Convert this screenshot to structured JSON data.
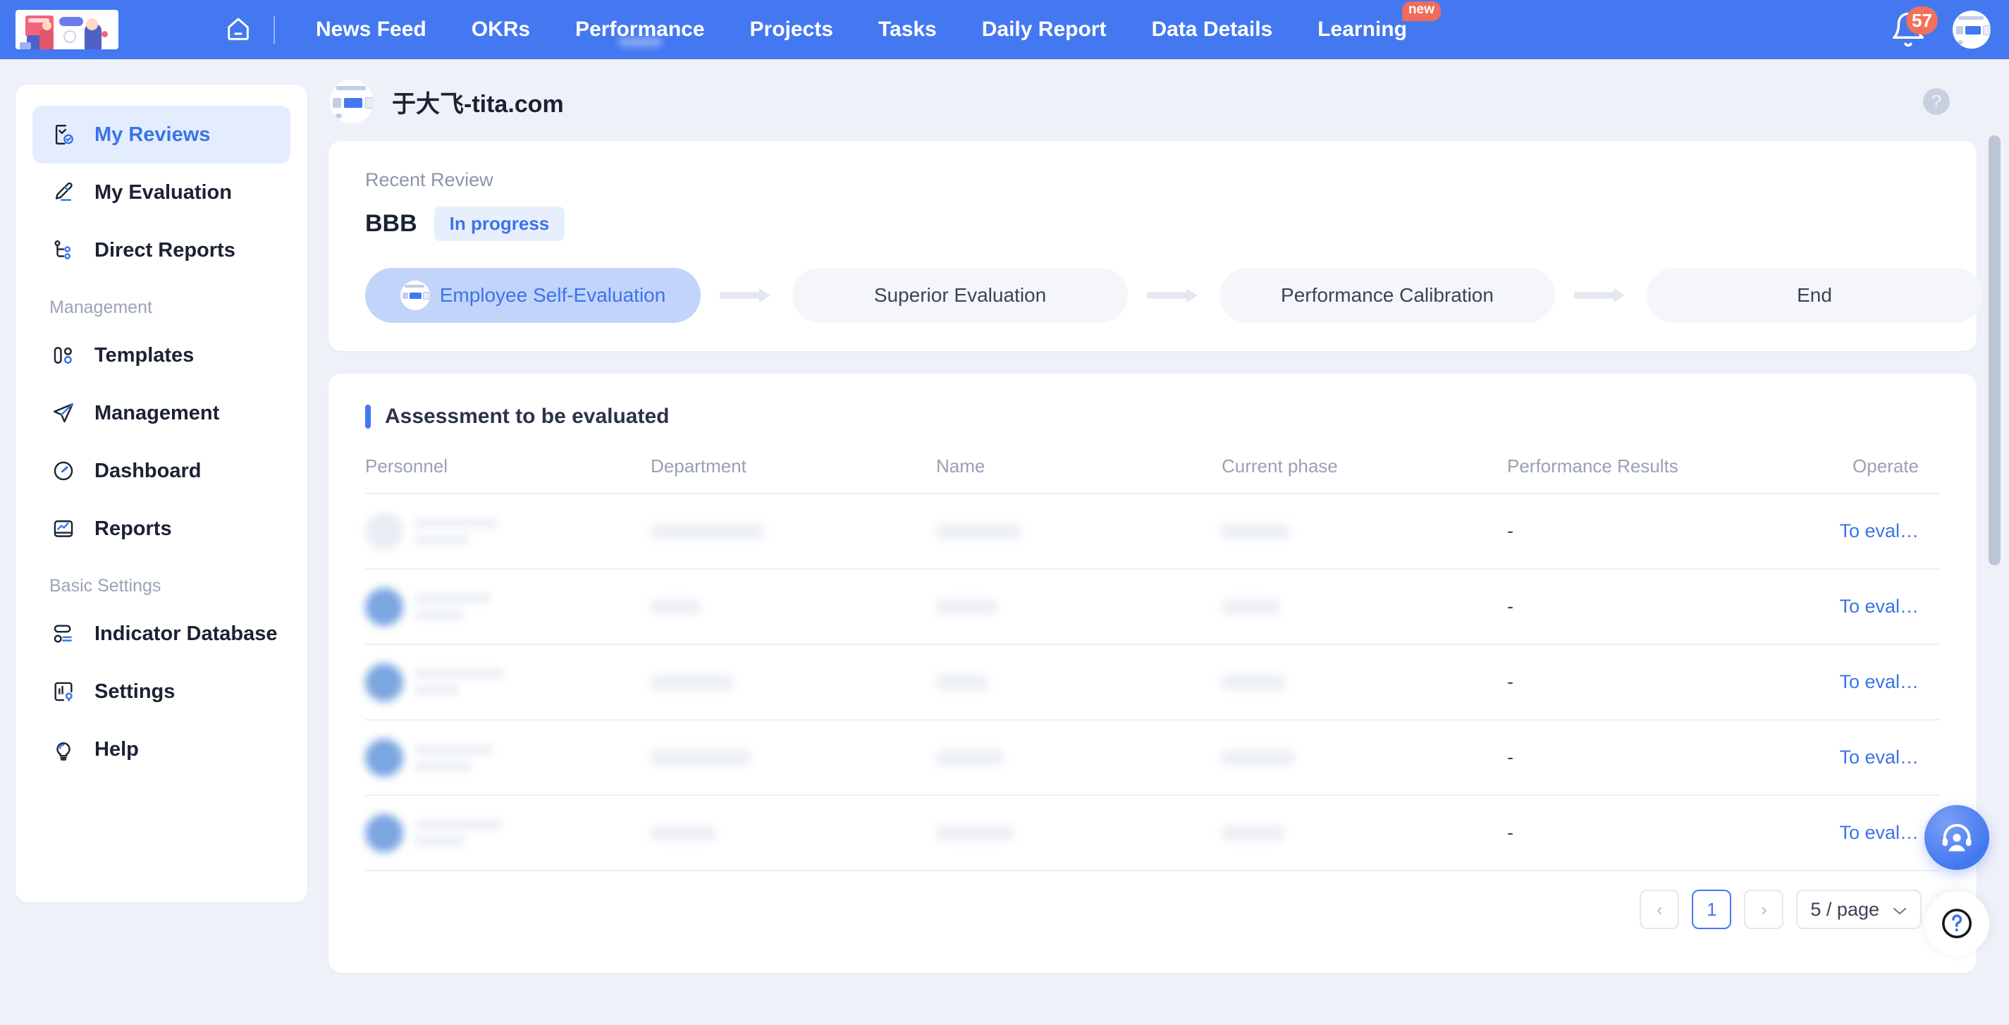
{
  "topnav": {
    "logo_name": "tita-logo",
    "home_icon": "home-icon",
    "items": [
      {
        "label": "News Feed",
        "active": false
      },
      {
        "label": "OKRs",
        "active": false
      },
      {
        "label": "Performance",
        "active": true
      },
      {
        "label": "Projects",
        "active": false
      },
      {
        "label": "Tasks",
        "active": false
      },
      {
        "label": "Daily Report",
        "active": false
      },
      {
        "label": "Data Details",
        "active": false
      },
      {
        "label": "Learning",
        "active": false,
        "badge": "new"
      }
    ],
    "notification_count": "57",
    "accent_color": "#4478f0",
    "badge_color": "#ef6b5c"
  },
  "sidebar": {
    "items": [
      {
        "label": "My Reviews",
        "icon": "review-report-icon",
        "active": true
      },
      {
        "label": "My Evaluation",
        "icon": "pencil-edit-icon",
        "active": false
      },
      {
        "label": "Direct Reports",
        "icon": "org-tree-icon",
        "active": false
      }
    ],
    "group_management": {
      "title": "Management",
      "items": [
        {
          "label": "Templates",
          "icon": "templates-icon"
        },
        {
          "label": "Management",
          "icon": "paper-plane-icon"
        },
        {
          "label": "Dashboard",
          "icon": "gauge-icon"
        },
        {
          "label": "Reports",
          "icon": "report-chart-icon"
        }
      ]
    },
    "group_basic": {
      "title": "Basic Settings",
      "items": [
        {
          "label": "Indicator Database",
          "icon": "database-list-icon"
        },
        {
          "label": "Settings",
          "icon": "settings-chart-icon"
        },
        {
          "label": "Help",
          "icon": "lightbulb-icon"
        }
      ]
    }
  },
  "header": {
    "title": "于大飞-tita.com",
    "avatar": "user-avatar",
    "help_icon": "question-mark-icon"
  },
  "recent": {
    "label": "Recent Review",
    "name": "BBB",
    "status": "In progress",
    "status_color": "#3b74e8",
    "steps": [
      {
        "label": "Employee Self-Evaluation",
        "active": true,
        "has_avatar": true
      },
      {
        "label": "Superior Evaluation",
        "active": false,
        "has_avatar": false
      },
      {
        "label": "Performance Calibration",
        "active": false,
        "has_avatar": false
      },
      {
        "label": "End",
        "active": false,
        "has_avatar": false
      }
    ]
  },
  "assessment": {
    "title": "Assessment to be evaluated",
    "columns": [
      "Personnel",
      "Department",
      "Name",
      "Current phase",
      "Performance Results",
      "Operate"
    ],
    "rows": [
      {
        "personnel": "",
        "department": "",
        "name": "",
        "phase": "",
        "results": "-",
        "operate": "To eval…",
        "redacted": true,
        "avatar_blue": false
      },
      {
        "personnel": "",
        "department": "",
        "name": "",
        "phase": "",
        "results": "-",
        "operate": "To eval…",
        "redacted": true,
        "avatar_blue": true
      },
      {
        "personnel": "",
        "department": "",
        "name": "",
        "phase": "",
        "results": "-",
        "operate": "To eval…",
        "redacted": true,
        "avatar_blue": true
      },
      {
        "personnel": "",
        "department": "",
        "name": "",
        "phase": "",
        "results": "-",
        "operate": "To eval…",
        "redacted": true,
        "avatar_blue": true
      },
      {
        "personnel": "",
        "department": "",
        "name": "",
        "phase": "",
        "results": "-",
        "operate": "To eval…",
        "redacted": true,
        "avatar_blue": true
      }
    ]
  },
  "pagination": {
    "prev": "‹",
    "current_page": "1",
    "next": "›",
    "page_size": "5 / page"
  },
  "floating": {
    "service_icon": "customer-service-headset-icon",
    "help_icon": "question-circle-icon"
  }
}
